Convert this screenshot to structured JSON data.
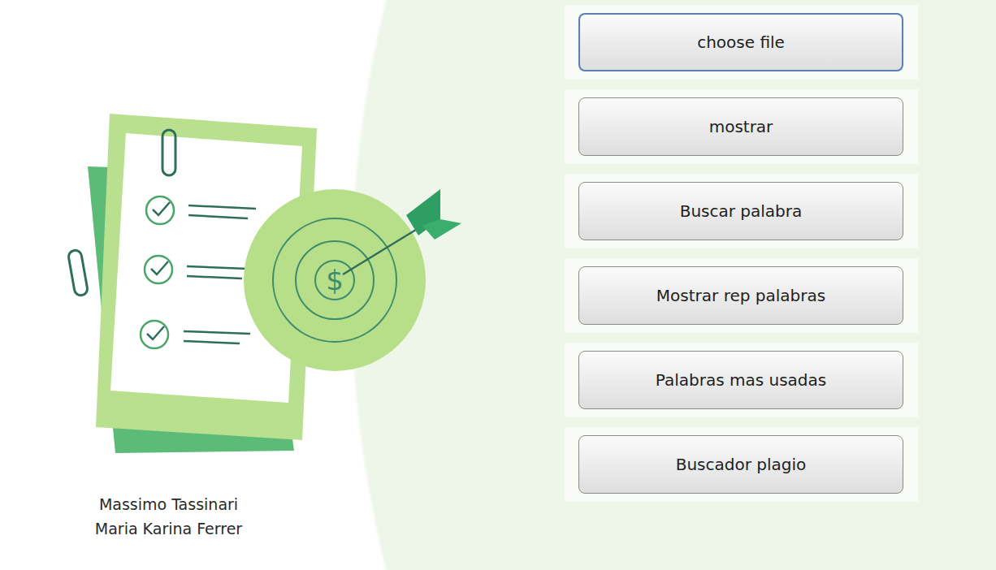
{
  "illustration": {
    "target_symbol": "$"
  },
  "authors": [
    "Massimo Tassinari",
    "Maria Karina Ferrer"
  ],
  "buttons": [
    {
      "label": "choose file",
      "focused": true
    },
    {
      "label": "mostrar",
      "focused": false
    },
    {
      "label": "Buscar palabra",
      "focused": false
    },
    {
      "label": "Mostrar rep palabras",
      "focused": false
    },
    {
      "label": "Palabras mas usadas",
      "focused": false
    },
    {
      "label": "Buscador plagio",
      "focused": false
    }
  ]
}
